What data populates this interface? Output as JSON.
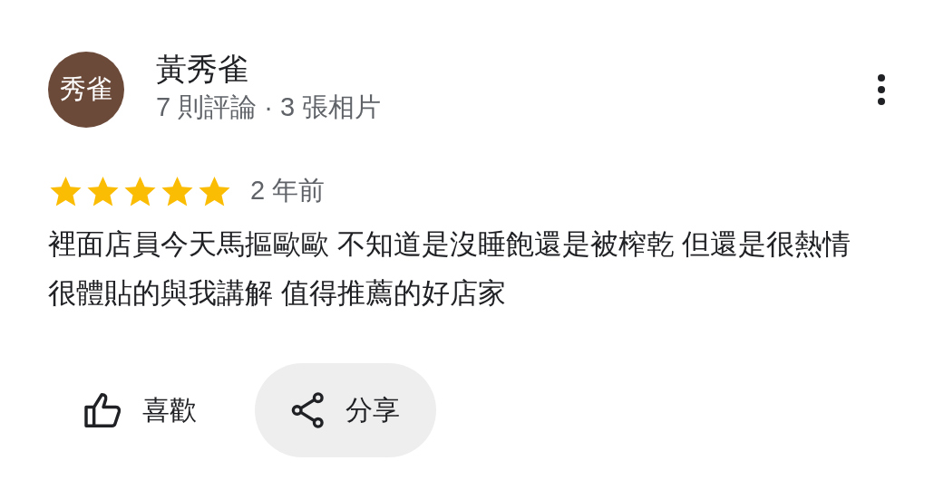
{
  "reviewer": {
    "avatar_text": "秀雀",
    "name": "黃秀雀",
    "meta": "7 則評論 · 3 張相片"
  },
  "review": {
    "stars": 5,
    "time": "2 年前",
    "text": "裡面店員今天馬摳歐歐 不知道是沒睡飽還是被榨乾 但還是很熱情很體貼的與我講解 值得推薦的好店家"
  },
  "actions": [
    {
      "kind": "like",
      "label": "喜歡",
      "selected": false
    },
    {
      "kind": "share",
      "label": "分享",
      "selected": true
    }
  ]
}
